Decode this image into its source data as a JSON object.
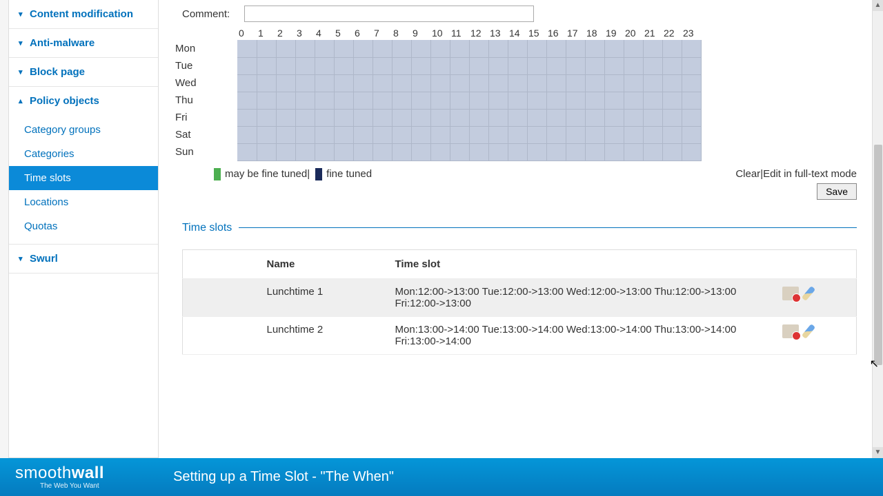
{
  "sidebar": {
    "sections": [
      {
        "label": "Content modification",
        "expanded": false
      },
      {
        "label": "Anti-malware",
        "expanded": false
      },
      {
        "label": "Block page",
        "expanded": false
      },
      {
        "label": "Policy objects",
        "expanded": true,
        "items": [
          {
            "label": "Category groups",
            "active": false
          },
          {
            "label": "Categories",
            "active": false
          },
          {
            "label": "Time slots",
            "active": true
          },
          {
            "label": "Locations",
            "active": false
          },
          {
            "label": "Quotas",
            "active": false
          }
        ]
      },
      {
        "label": "Swurl",
        "expanded": false
      }
    ]
  },
  "form": {
    "comment_label": "Comment:",
    "comment_value": ""
  },
  "schedule": {
    "hours": [
      "0",
      "1",
      "2",
      "3",
      "4",
      "5",
      "6",
      "7",
      "8",
      "9",
      "10",
      "11",
      "12",
      "13",
      "14",
      "15",
      "16",
      "17",
      "18",
      "19",
      "20",
      "21",
      "22",
      "23"
    ],
    "days": [
      "Mon",
      "Tue",
      "Wed",
      "Thu",
      "Fri",
      "Sat",
      "Sun"
    ]
  },
  "legend": {
    "may": "may be fine tuned",
    "sep": " | ",
    "fine": "fine tuned",
    "clear": "Clear",
    "pipe": " | ",
    "edit": "Edit in full-text mode"
  },
  "save_label": "Save",
  "slots_heading": "Time slots",
  "slots_table": {
    "headers": {
      "name": "Name",
      "slot": "Time slot"
    },
    "rows": [
      {
        "name": "Lunchtime 1",
        "slot": "Mon:12:00->13:00 Tue:12:00->13:00 Wed:12:00->13:00 Thu:12:00->13:00 Fri:12:00->13:00"
      },
      {
        "name": "Lunchtime 2",
        "slot": "Mon:13:00->14:00 Tue:13:00->14:00 Wed:13:00->14:00 Thu:13:00->14:00 Fri:13:00->14:00"
      }
    ]
  },
  "footer": {
    "brand1": "smooth",
    "brand2": "wall",
    "tagline": "The Web You Want",
    "caption": "Setting up a Time Slot - \"The When\""
  }
}
